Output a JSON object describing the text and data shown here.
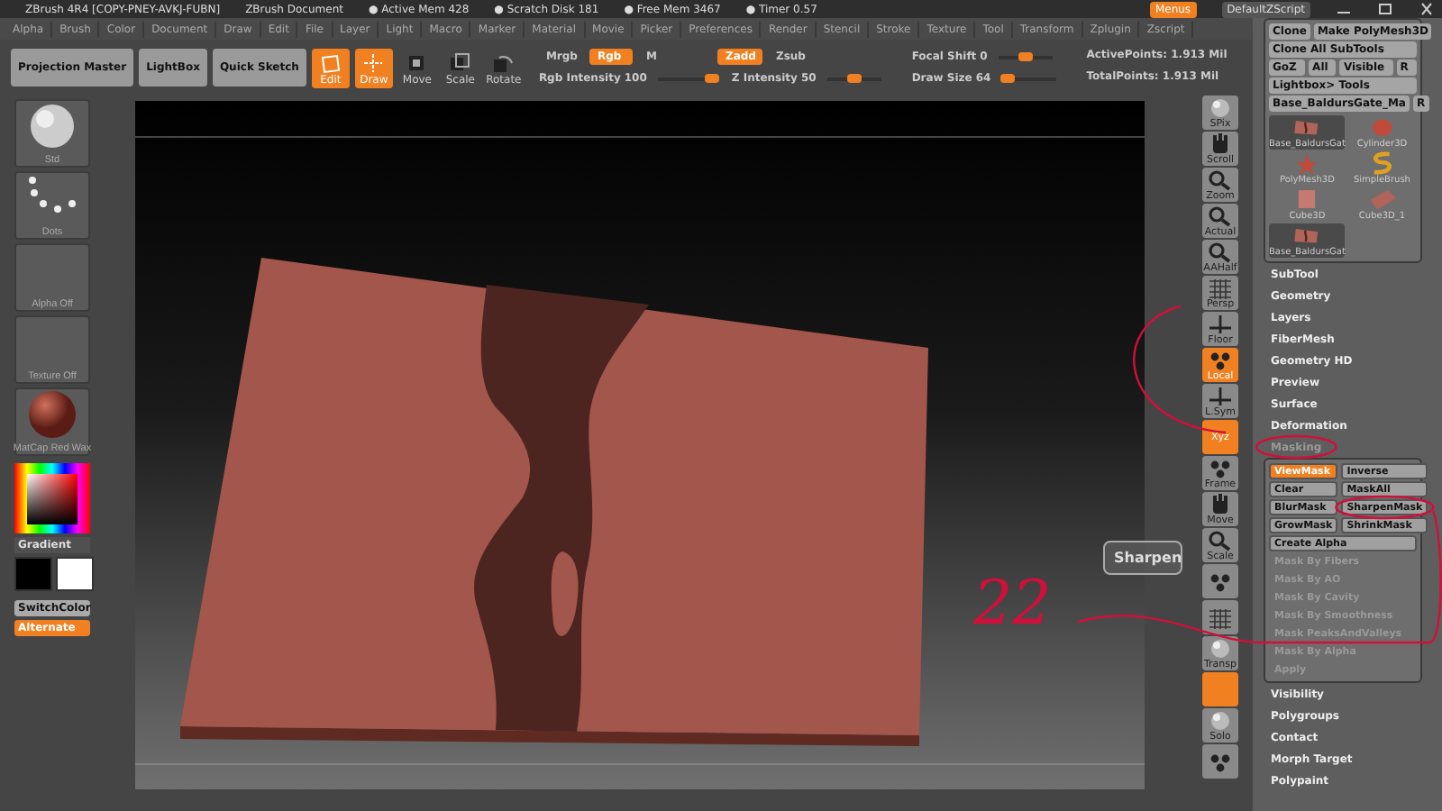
{
  "title_bar": {
    "app": "ZBrush 4R4 [COPY-PNEY-AVKJ-FUBN]",
    "document": "ZBrush Document",
    "stats": [
      "● Active Mem 428",
      "● Scratch Disk 181",
      "● Free Mem 3467",
      "● Timer 0.57"
    ],
    "buttons": [
      {
        "label": "Menus",
        "selected": true
      },
      {
        "label": "DefaultZScript",
        "selected": false
      }
    ]
  },
  "menu_bar": [
    "Alpha",
    "Brush",
    "Color",
    "Document",
    "Draw",
    "Edit",
    "File",
    "Layer",
    "Light",
    "Macro",
    "Marker",
    "Material",
    "Movie",
    "Picker",
    "Preferences",
    "Render",
    "Stencil",
    "Stroke",
    "Texture",
    "Tool",
    "Transform",
    "Zplugin",
    "Zscript"
  ],
  "toolbar": {
    "buttons": [
      "Projection Master",
      "LightBox",
      "Quick Sketch"
    ],
    "modes": [
      {
        "label": "Edit",
        "kind": "edit",
        "selected": true
      },
      {
        "label": "Draw",
        "kind": "draw",
        "selected": true
      },
      {
        "label": "Move",
        "kind": "move",
        "selected": false
      },
      {
        "label": "Scale",
        "kind": "scale",
        "selected": false
      },
      {
        "label": "Rotate",
        "kind": "rotate",
        "selected": false
      }
    ],
    "color_toggles": [
      {
        "label": "Mrgb",
        "selected": false
      },
      {
        "label": "Rgb",
        "selected": true
      },
      {
        "label": "M",
        "selected": false
      }
    ],
    "depth_toggles": [
      {
        "label": "Zadd",
        "selected": true
      },
      {
        "label": "Zsub",
        "selected": false
      }
    ],
    "intensity_sliders": [
      {
        "label": "Rgb Intensity",
        "value": "100",
        "level": 1
      },
      {
        "label": "Z Intensity",
        "value": "50",
        "level": 0.5
      }
    ],
    "brush_sliders": [
      {
        "label": "Focal Shift",
        "value": "0",
        "level": 0.5
      },
      {
        "label": "Draw Size",
        "value": "64",
        "level": 0.1
      }
    ],
    "points": [
      "ActivePoints: 1.913 Mil",
      "TotalPoints: 1.913 Mil"
    ]
  },
  "left_shelf": {
    "thumbs": [
      {
        "label": "Std",
        "kind": "brush"
      },
      {
        "label": "Dots",
        "kind": "stroke"
      },
      {
        "label": "Alpha Off",
        "kind": "empty"
      },
      {
        "label": "Texture Off",
        "kind": "empty"
      },
      {
        "label": "MatCap Red Wax",
        "kind": "material"
      }
    ],
    "gradient": "Gradient",
    "switch_color": "SwitchColor",
    "alternate": {
      "label": "Alternate",
      "on": true
    }
  },
  "right_shelf": [
    {
      "label": "SPix",
      "kind": "sphere",
      "selected": false
    },
    {
      "label": "Scroll",
      "kind": "hand",
      "selected": false
    },
    {
      "label": "Zoom",
      "kind": "magnifier",
      "selected": false
    },
    {
      "label": "Actual",
      "kind": "magnifier",
      "selected": false
    },
    {
      "label": "AAHalf",
      "kind": "magnifier",
      "selected": false
    },
    {
      "label": "Persp",
      "kind": "grid",
      "selected": false
    },
    {
      "label": "Floor",
      "kind": "axes",
      "selected": false
    },
    {
      "label": "Local",
      "kind": "dots",
      "selected": true
    },
    {
      "label": "L.Sym",
      "kind": "axes",
      "selected": false
    },
    {
      "label": "Xyz",
      "kind": "none",
      "selected": true
    },
    {
      "label": "Frame",
      "kind": "dots",
      "selected": false
    },
    {
      "label": "Move",
      "kind": "hand",
      "selected": false
    },
    {
      "label": "Scale",
      "kind": "magnifier",
      "selected": false
    },
    {
      "kind": "dots",
      "selected": false
    },
    {
      "kind": "grid",
      "selected": false
    },
    {
      "label": "Transp",
      "kind": "sphere",
      "selected": false
    },
    {
      "kind": "none",
      "selected": true
    },
    {
      "label": "Solo",
      "kind": "sphere",
      "selected": false
    },
    {
      "kind": "dots",
      "selected": false
    }
  ],
  "tool_panel": {
    "rows": [
      [
        "Clone",
        "Make PolyMesh3D"
      ],
      [
        "Clone All SubTools"
      ],
      [
        "GoZ",
        "All",
        "Visible",
        "R"
      ],
      [
        "Lightbox> Tools"
      ],
      [
        "Base_BaldursGate_Ma",
        "R"
      ]
    ],
    "thumbs": [
      {
        "label": "Base_BaldursGat",
        "kind": "slab",
        "selected": true
      },
      {
        "label": "Cylinder3D",
        "kind": "cylinder",
        "selected": false
      },
      {
        "label": "PolyMesh3D",
        "kind": "star",
        "selected": false
      },
      {
        "label": "SimpleBrush",
        "kind": "brush",
        "selected": false
      },
      {
        "label": "Cube3D",
        "kind": "cube",
        "selected": false
      },
      {
        "label": "Cube3D_1",
        "kind": "flat",
        "selected": false
      },
      {
        "label": "Base_BaldursGat",
        "kind": "slab",
        "selected": true
      }
    ]
  },
  "tool_menu": {
    "before": [
      "SubTool",
      "Geometry",
      "Layers",
      "FiberMesh",
      "Geometry HD",
      "Preview",
      "Surface",
      "Deformation"
    ],
    "masking": {
      "title": "Masking",
      "buttons": [
        {
          "label": "ViewMask",
          "selected": true
        },
        {
          "label": "Inverse",
          "selected": false
        },
        {
          "label": "Clear",
          "selected": false
        },
        {
          "label": "MaskAll",
          "selected": false
        },
        {
          "label": "BlurMask",
          "selected": false
        },
        {
          "label": "SharpenMask",
          "selected": false
        },
        {
          "label": "GrowMask",
          "selected": false
        },
        {
          "label": "ShrinkMask",
          "selected": false
        }
      ],
      "items": [
        {
          "label": "Create Alpha",
          "disabled": false
        },
        {
          "label": "Mask By Fibers",
          "disabled": true
        },
        {
          "label": "Mask By AO",
          "disabled": true
        },
        {
          "label": "Mask By Cavity",
          "disabled": true
        },
        {
          "label": "Mask By Smoothness",
          "disabled": true
        },
        {
          "label": "Mask PeaksAndValleys",
          "disabled": true
        },
        {
          "label": "Mask By Alpha",
          "disabled": true
        },
        {
          "label": "Apply",
          "disabled": true
        }
      ]
    },
    "after": [
      "Visibility",
      "Polygroups",
      "Contact",
      "Morph Target",
      "Polypaint"
    ]
  },
  "tooltip": "Sharpen",
  "annotation": {
    "text": "22"
  }
}
